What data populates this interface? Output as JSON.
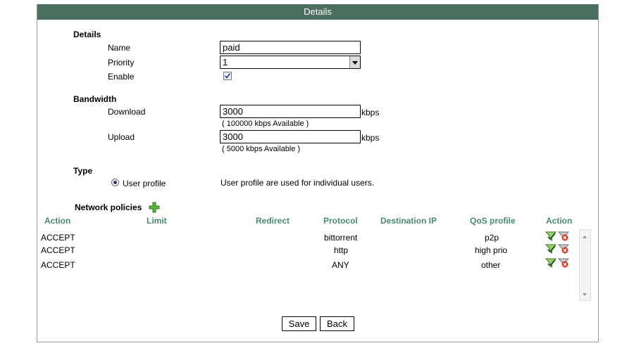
{
  "title": "Details",
  "details": {
    "section_label": "Details",
    "name_label": "Name",
    "name_value": "paid",
    "priority_label": "Priority",
    "priority_value": "1",
    "enable_label": "Enable",
    "enable_checked": true
  },
  "bandwidth": {
    "section_label": "Bandwidth",
    "download_label": "Download",
    "download_value": "3000",
    "download_unit": "kbps",
    "download_available": "( 100000 kbps Available )",
    "upload_label": "Upload",
    "upload_value": "3000",
    "upload_unit": "kbps",
    "upload_available": "( 5000 kbps Available )"
  },
  "type": {
    "section_label": "Type",
    "option_label": "User profile",
    "description": "User profile are used for individual users."
  },
  "policies": {
    "section_label": "Network policies",
    "columns": [
      "Action",
      "Limit",
      "Redirect",
      "Protocol",
      "Destination IP",
      "QoS profile",
      "Action"
    ],
    "rows": [
      {
        "action": "ACCEPT",
        "limit": "",
        "redirect": "",
        "protocol": "bittorrent",
        "destination_ip": "",
        "qos_profile": "p2p"
      },
      {
        "action": "ACCEPT",
        "limit": "",
        "redirect": "",
        "protocol": "http",
        "destination_ip": "",
        "qos_profile": "high prio"
      },
      {
        "action": "ACCEPT",
        "limit": "",
        "redirect": "",
        "protocol": "ANY",
        "destination_ip": "",
        "qos_profile": "other"
      }
    ]
  },
  "buttons": {
    "save": "Save",
    "back": "Back"
  },
  "colors": {
    "titlebar": "#4a6f5f",
    "column_header": "#4a8a74"
  }
}
